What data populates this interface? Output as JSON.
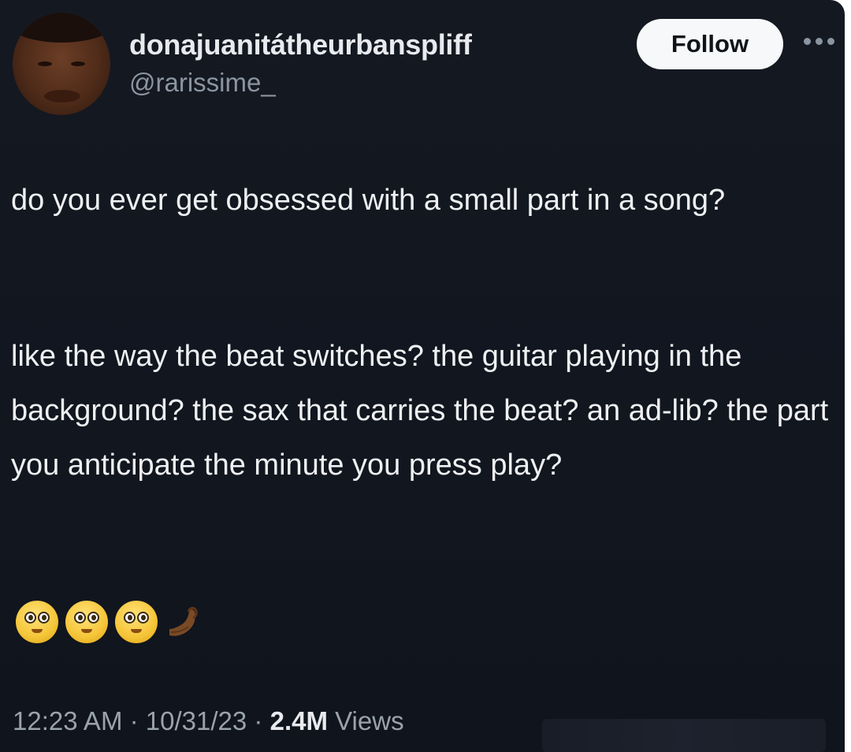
{
  "tweet": {
    "author": {
      "display_name": "donajuanitátheurbanspliff",
      "handle": "@rarissime_"
    },
    "follow_label": "Follow",
    "text_paragraphs": [
      "do you ever get obsessed with a small part in a song?",
      "like the way the beat switches? the guitar playing in the background? the sax that carries the beat? an ad-lib? the part you anticipate the minute you press play?"
    ],
    "emojis": [
      "pleading-face-emoji",
      "pleading-face-emoji",
      "pleading-face-emoji",
      "pinched-fingers-emoji"
    ],
    "meta": {
      "time": "12:23 AM",
      "separator": "·",
      "date": "10/31/23",
      "views_count": "2.4M",
      "views_label": "Views"
    }
  },
  "icons": {
    "more": "more-options-icon"
  },
  "colors": {
    "background": "#141821",
    "primary_text": "#eef0f2",
    "secondary_text": "#8b95a1",
    "follow_button_bg": "#f7f8f9"
  }
}
